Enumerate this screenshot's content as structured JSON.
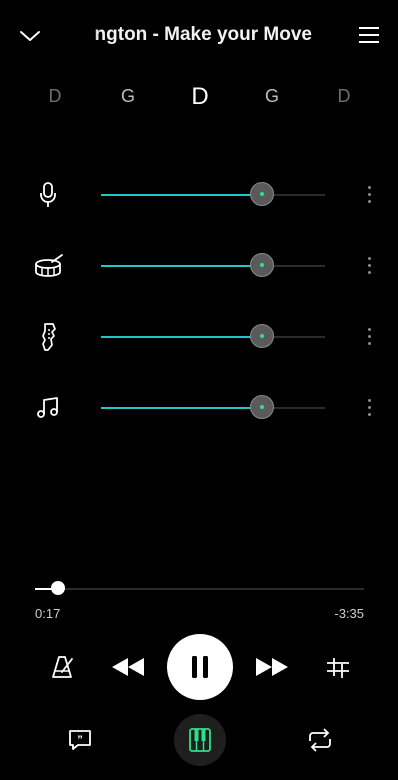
{
  "header": {
    "title": "ngton - Make your Move"
  },
  "chords": [
    {
      "label": "D",
      "color": "#6e6e6e"
    },
    {
      "label": "G",
      "color": "#bdbdbd"
    },
    {
      "label": "D",
      "color": "#ffffff"
    },
    {
      "label": "G",
      "color": "#bdbdbd"
    },
    {
      "label": "D",
      "color": "#6e6e6e"
    }
  ],
  "tracks": [
    {
      "icon": "microphone-icon",
      "level": 0.72
    },
    {
      "icon": "drum-icon",
      "level": 0.72
    },
    {
      "icon": "bass-guitar-icon",
      "level": 0.72
    },
    {
      "icon": "music-note-icon",
      "level": 0.72
    }
  ],
  "playback": {
    "elapsed": "0:17",
    "remaining": "-3:35",
    "progress": 0.07,
    "state": "playing"
  },
  "colors": {
    "accent": "#20c8c8",
    "knob_dot": "#2ee08a",
    "chords_button": "#2ee08a"
  }
}
